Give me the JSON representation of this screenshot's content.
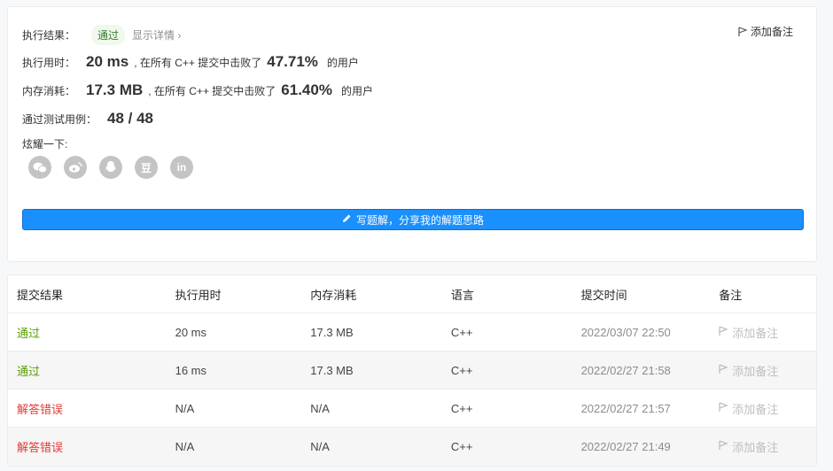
{
  "result": {
    "exec_result_label": "执行结果：",
    "status": "通过",
    "show_detail": "显示详情 ›",
    "add_note": "添加备注",
    "runtime_label": "执行用时：",
    "runtime_value": "20 ms",
    "runtime_mid": ", 在所有 C++ 提交中击败了",
    "runtime_pct": "47.71%",
    "runtime_tail": "的用户",
    "memory_label": "内存消耗：",
    "memory_value": "17.3 MB",
    "memory_mid": ", 在所有 C++ 提交中击败了",
    "memory_pct": "61.40%",
    "memory_tail": "的用户",
    "tests_label": "通过测试用例：",
    "tests_value": "48 / 48",
    "share_label": "炫耀一下:",
    "share_icons": [
      "wechat-icon",
      "weibo-icon",
      "qq-icon",
      "douban-icon",
      "linkedin-icon"
    ],
    "douban_glyph": "豆",
    "linkedin_glyph": "in",
    "write_button": "写题解，分享我的解题思路"
  },
  "table": {
    "headers": [
      "提交结果",
      "执行用时",
      "内存消耗",
      "语言",
      "提交时间",
      "备注"
    ],
    "rows": [
      {
        "status": "通过",
        "runtime": "20 ms",
        "memory": "17.3 MB",
        "lang": "C++",
        "time": "2022/03/07 22:50",
        "note": "添加备注"
      },
      {
        "status": "通过",
        "runtime": "16 ms",
        "memory": "17.3 MB",
        "lang": "C++",
        "time": "2022/02/27 21:58",
        "note": "添加备注"
      },
      {
        "status": "解答错误",
        "runtime": "N/A",
        "memory": "N/A",
        "lang": "C++",
        "time": "2022/02/27 21:57",
        "note": "添加备注"
      },
      {
        "status": "解答错误",
        "runtime": "N/A",
        "memory": "N/A",
        "lang": "C++",
        "time": "2022/02/27 21:49",
        "note": "添加备注"
      }
    ]
  },
  "colors": {
    "accent": "#1a90ff",
    "success": "#5c9e00",
    "error": "#e53935"
  }
}
